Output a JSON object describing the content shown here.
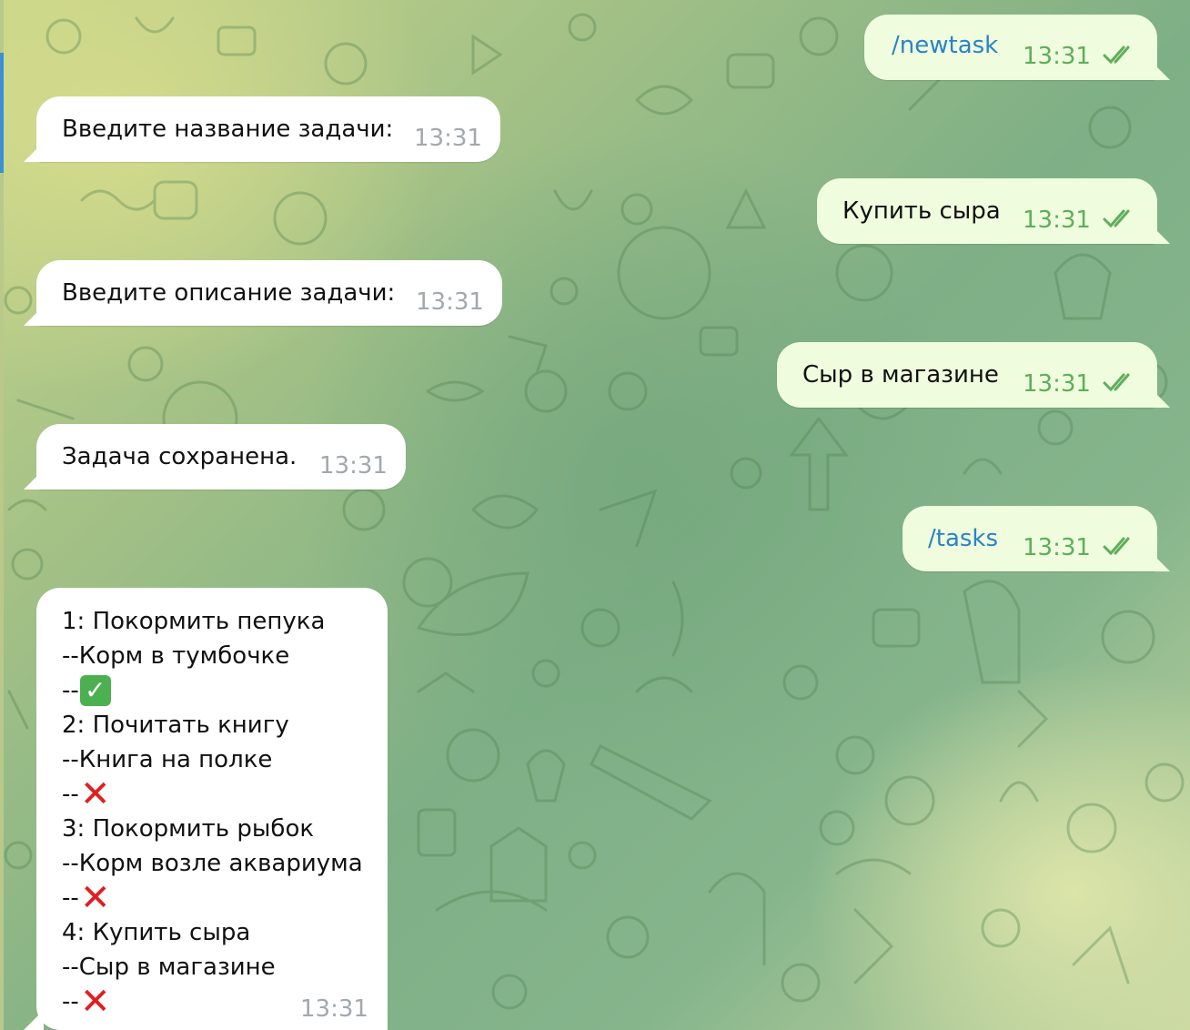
{
  "chat": {
    "messages": [
      {
        "id": "m1",
        "direction": "outgoing",
        "text": "/newtask",
        "time": "13:31",
        "status": "read"
      },
      {
        "id": "m2",
        "direction": "incoming",
        "text": "Введите название задачи:",
        "time": "13:31"
      },
      {
        "id": "m3",
        "direction": "outgoing",
        "text": "Купить сыра",
        "time": "13:31",
        "status": "read"
      },
      {
        "id": "m4",
        "direction": "incoming",
        "text": "Введите описание задачи:",
        "time": "13:31"
      },
      {
        "id": "m5",
        "direction": "outgoing",
        "text": "Сыр в магазине",
        "time": "13:31",
        "status": "read"
      },
      {
        "id": "m6",
        "direction": "incoming",
        "text": "Задача сохранена.",
        "time": "13:31"
      },
      {
        "id": "m7",
        "direction": "outgoing",
        "text": "/tasks",
        "time": "13:31",
        "status": "read"
      }
    ],
    "task_list_message": {
      "time": "13:31",
      "tasks": [
        {
          "title": "1: Покормить пепука",
          "description": "--Корм в тумбочке",
          "status_prefix": "--",
          "done": true
        },
        {
          "title": "2: Почитать книгу",
          "description": "--Книга на полке",
          "status_prefix": "--",
          "done": false
        },
        {
          "title": "3: Покормить рыбок",
          "description": "--Корм возле аквариума",
          "status_prefix": "--",
          "done": false
        },
        {
          "title": "4: Купить сыра",
          "description": "--Сыр в магазине",
          "status_prefix": "--",
          "done": false
        }
      ],
      "done_mark": "✓",
      "not_done_mark": "✕"
    }
  },
  "colors": {
    "incoming_bubble": "#ffffff",
    "outgoing_bubble": "#effdde",
    "command_link": "#2b83c6",
    "outgoing_time": "#5fae5a",
    "incoming_time": "#a2a8ad",
    "done_mark": "#4cb050",
    "not_done_mark": "#e01f1f"
  }
}
